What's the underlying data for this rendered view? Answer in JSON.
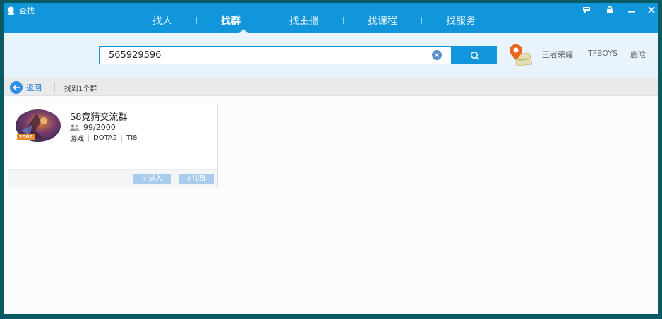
{
  "window": {
    "title": "查找",
    "controls": [
      "feedback-icon",
      "lock-icon",
      "minimize-icon",
      "close-icon"
    ]
  },
  "tabs": [
    {
      "label": "找人",
      "active": false
    },
    {
      "label": "找群",
      "active": true
    },
    {
      "label": "找主播",
      "active": false
    },
    {
      "label": "找课程",
      "active": false
    },
    {
      "label": "找服务",
      "active": false
    }
  ],
  "search": {
    "value": "565929596",
    "placeholder": "",
    "hot_keywords": [
      "王者荣耀",
      "TFBOYS",
      "鹿晗"
    ]
  },
  "toolbar": {
    "back_label": "返回",
    "result_count": "找到1个群"
  },
  "results": [
    {
      "name": "S8竞猜交流群",
      "members": "99/2000",
      "badge": "2000",
      "tags": [
        "游戏",
        "DOTA2",
        "TI8"
      ],
      "enter_label": "» 进入",
      "join_label": "+加群"
    }
  ],
  "colors": {
    "brand": "#1296db",
    "search_bg": "#e9f3fb",
    "button_disabled": "#a9ccec",
    "back": "#2f8ee6"
  }
}
